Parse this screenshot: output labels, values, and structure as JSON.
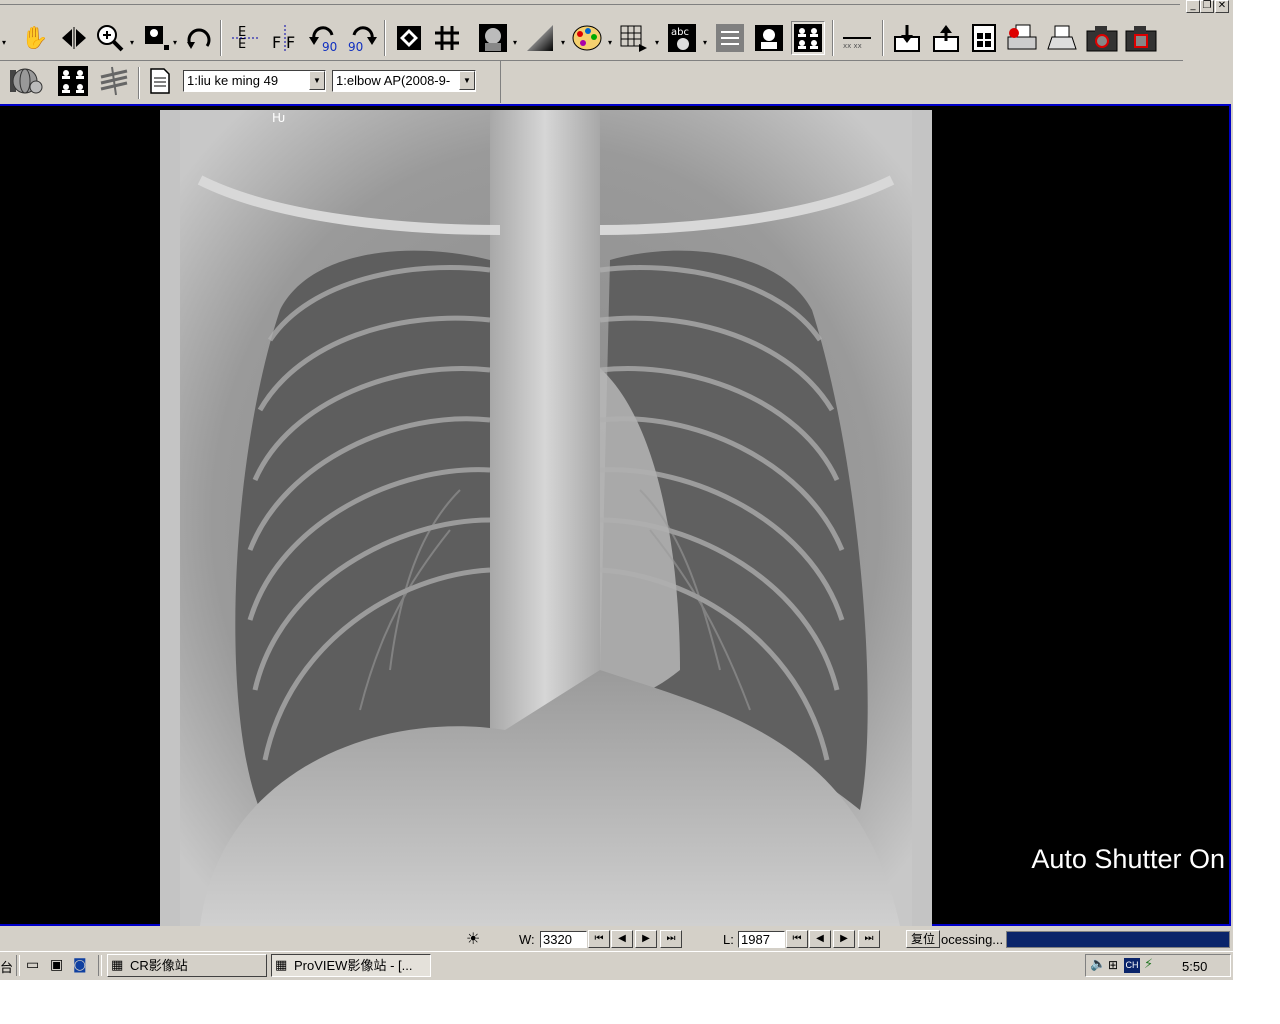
{
  "toolbar1": {
    "icons": [
      "pan-hand-icon",
      "flip-horizontal-icon",
      "zoom-icon",
      "magnify-icon",
      "rotate-free-icon",
      "flip-vertical-icon",
      "flip-text-icon",
      "rotate-left-90-icon",
      "rotate-right-90-icon",
      "invert-icon",
      "grid-icon",
      "portrait-icon",
      "window-level-icon",
      "color-palette-icon",
      "layout-icon",
      "annotation-icon",
      "text-overlay-icon",
      "person-icon",
      "four-person-icon",
      "measure-line-icon",
      "export-icon",
      "import-icon",
      "save-icon",
      "print-preview-icon",
      "print-icon",
      "camera-1-icon",
      "camera-2-icon"
    ],
    "rot_left_label": "90",
    "rot_right_label": "90",
    "annotation_label": "abc"
  },
  "toolbar2": {
    "patient_select": "1:liu ke ming 49",
    "series_select": "1:elbow AP(2008-9-"
  },
  "viewer": {
    "overlay_text": "Auto Shutter On"
  },
  "statusbar": {
    "w_label": "W:",
    "w_value": "3320",
    "l_label": "L:",
    "l_value": "1987",
    "reset_label": "复位",
    "processing_text": "ocessing...",
    "progress": 1.0
  },
  "taskbar": {
    "tasks": [
      {
        "label": "CR影像站"
      },
      {
        "label": "ProVIEW影像站 - [..."
      }
    ],
    "clock": "5:50",
    "left_fragment": "台"
  },
  "colors": {
    "viewer_border": "#0000c8",
    "progress_fill": "#0a246a",
    "chrome": "#d4d0c8"
  }
}
